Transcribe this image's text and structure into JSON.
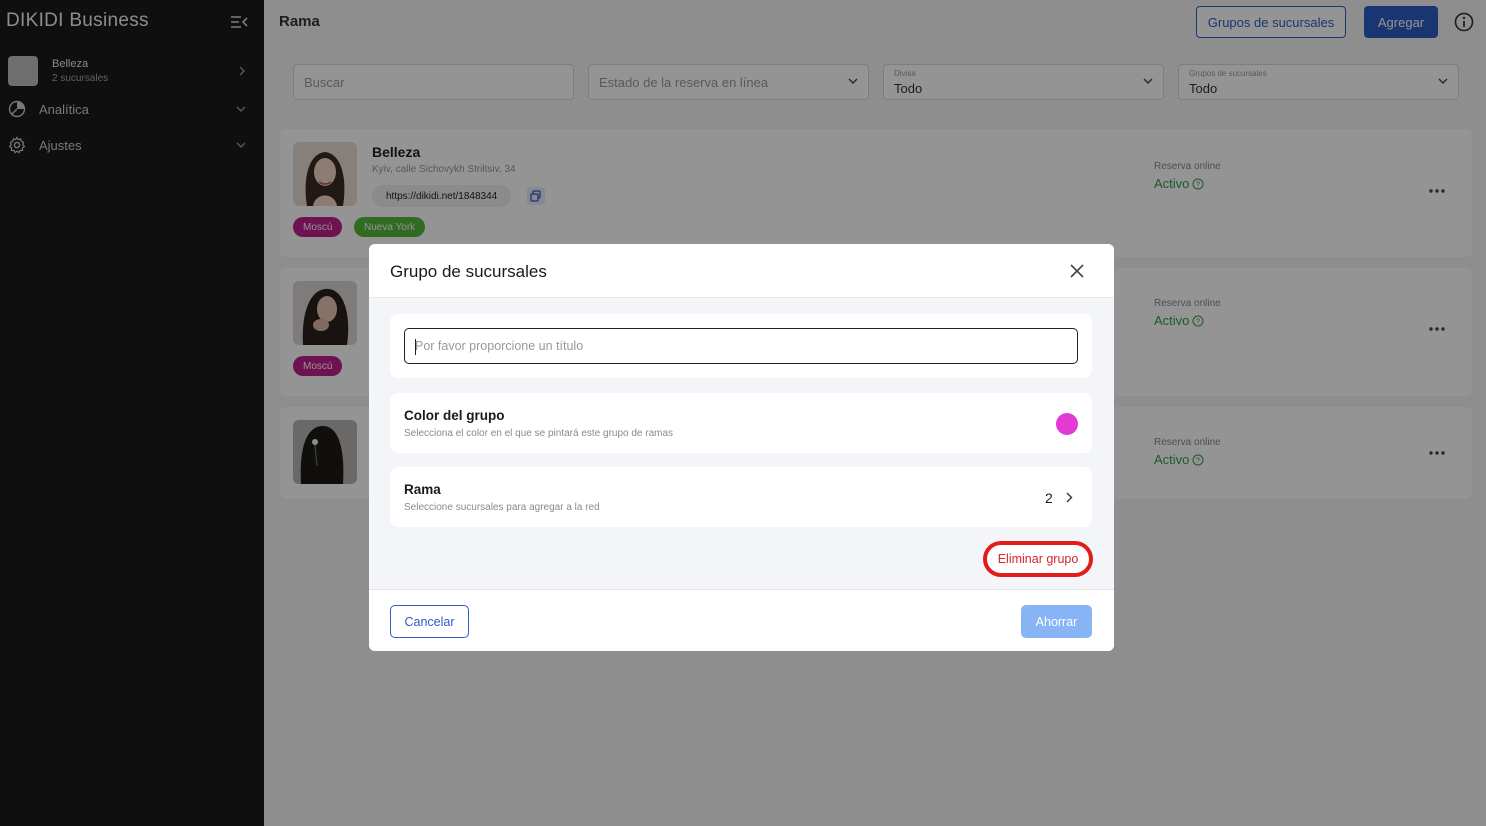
{
  "sidebar": {
    "brand": "DIKIDI Business",
    "org": {
      "name": "Belleza",
      "subtitle": "2 sucursales"
    },
    "items": [
      {
        "label": "Analítica",
        "icon": "pie-chart-icon"
      },
      {
        "label": "Ajustes",
        "icon": "gear-icon"
      }
    ]
  },
  "header": {
    "title": "Rama",
    "groups_button": "Grupos de sucursales",
    "add_button": "Agregar"
  },
  "filters": {
    "search_placeholder": "Buscar",
    "booking_status_placeholder": "Estado de la reserva en línea",
    "currency": {
      "label": "Divisa",
      "value": "Todo"
    },
    "branch_groups": {
      "label": "Grupos de sucursales",
      "value": "Todo"
    }
  },
  "branches": [
    {
      "name": "Belleza",
      "address": "Kyiv, calle Sichovykh Striltsiv, 34",
      "link": "https://dikidi.net/1848344",
      "tags": [
        {
          "label": "Moscú",
          "color": "#c0208e"
        },
        {
          "label": "Nueva York",
          "color": "#54b83a"
        }
      ],
      "reservation_label": "Reserva online",
      "reservation_status": "Activo"
    },
    {
      "tags": [
        {
          "label": "Moscú",
          "color": "#c0208e"
        }
      ],
      "reservation_label": "Reserva online",
      "reservation_status": "Activo"
    },
    {
      "reservation_label": "Reserva online",
      "reservation_status": "Activo"
    }
  ],
  "modal": {
    "title": "Grupo de sucursales",
    "title_placeholder": "Por favor proporcione un título",
    "color_section": {
      "title": "Color del grupo",
      "subtitle": "Selecciona el color en el que se pintará este grupo de ramas",
      "color": "#e53ad6"
    },
    "branch_section": {
      "title": "Rama",
      "subtitle": "Seleccione sucursales para agregar a la red",
      "count": "2"
    },
    "delete_button": "Eliminar grupo",
    "cancel_button": "Cancelar",
    "save_button": "Ahorrar"
  },
  "colors": {
    "primary": "#2c5cc5",
    "status_active": "#2e9e46",
    "danger": "#e21b1b",
    "save_disabled": "#86b4f5"
  }
}
